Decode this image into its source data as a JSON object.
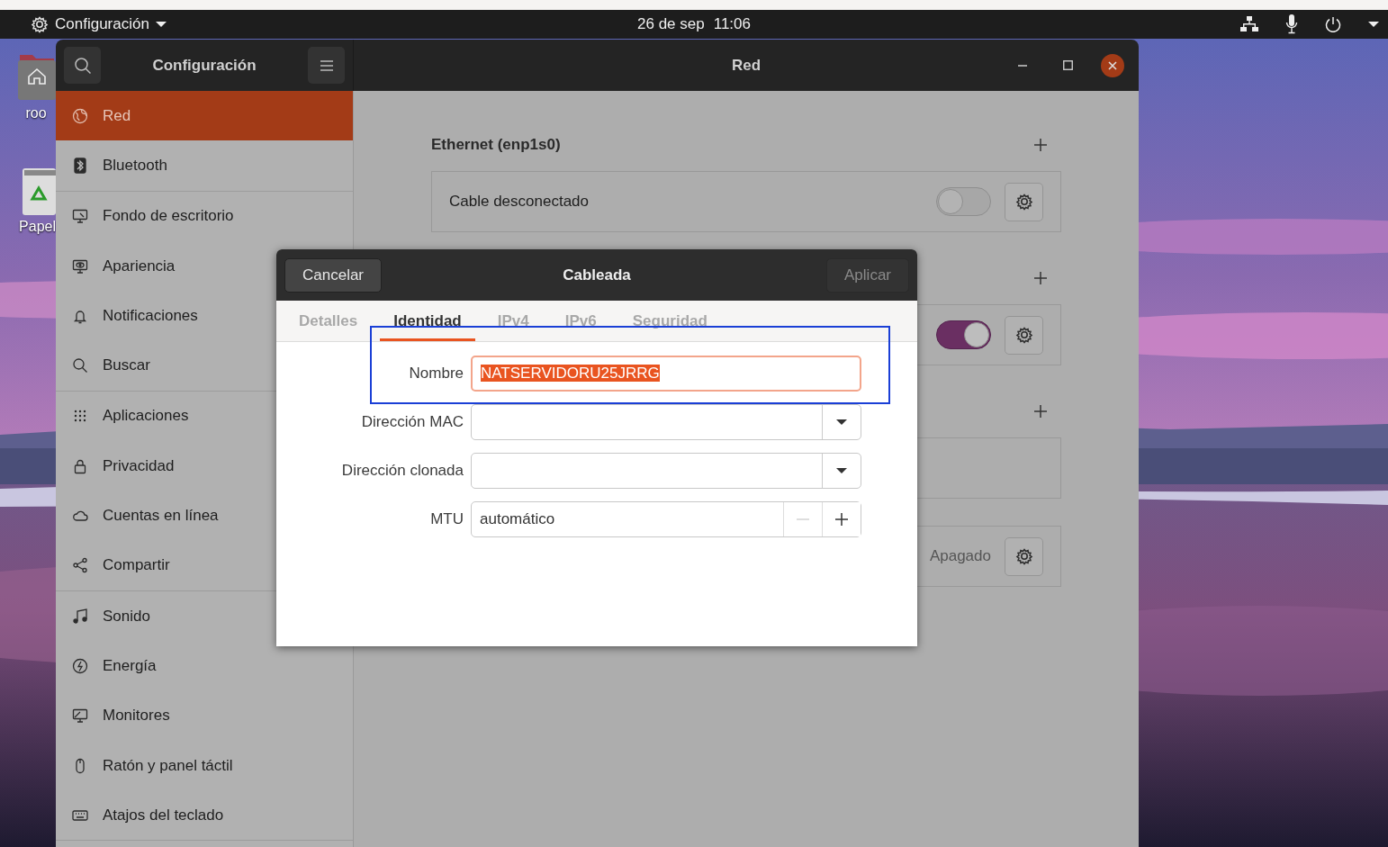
{
  "top_bar": {
    "app_menu": "Configuración",
    "date": "26 de sep",
    "time": "11:06"
  },
  "desktop_icons": [
    {
      "kind": "home",
      "label": "roo"
    },
    {
      "kind": "trash",
      "label": "Papel"
    }
  ],
  "settings": {
    "header_title": "Configuración",
    "page_title": "Red",
    "sidebar_groups": [
      {
        "items": [
          {
            "label": "Red",
            "selected": true
          },
          {
            "label": "Bluetooth",
            "selected": false
          }
        ]
      },
      {
        "items": [
          {
            "label": "Fondo de escritorio",
            "selected": false
          },
          {
            "label": "Apariencia",
            "selected": false
          },
          {
            "label": "Notificaciones",
            "selected": false
          },
          {
            "label": "Buscar",
            "selected": false
          }
        ]
      },
      {
        "items": [
          {
            "label": "Aplicaciones",
            "selected": false
          },
          {
            "label": "Privacidad",
            "selected": false
          },
          {
            "label": "Cuentas en línea",
            "selected": false
          },
          {
            "label": "Compartir",
            "selected": false
          }
        ]
      },
      {
        "items": [
          {
            "label": "Sonido",
            "selected": false
          },
          {
            "label": "Energía",
            "selected": false
          },
          {
            "label": "Monitores",
            "selected": false
          },
          {
            "label": "Ratón y panel táctil",
            "selected": false
          },
          {
            "label": "Atajos del teclado",
            "selected": false
          }
        ]
      }
    ],
    "sections": [
      {
        "title": "Ethernet (enp1s0)",
        "addable": true,
        "card": {
          "kind": "toggle",
          "label": "Cable desconectado",
          "on": false
        }
      },
      {
        "addable": true,
        "card": {
          "kind": "toggle",
          "on": true
        }
      },
      {
        "addable": true,
        "card": {
          "kind": "empty"
        }
      },
      {
        "addable": false,
        "card": {
          "kind": "status",
          "status": "Apagado"
        }
      }
    ]
  },
  "dialog": {
    "title": "Cableada",
    "cancel": "Cancelar",
    "apply": {
      "label": "Aplicar",
      "disabled": true
    },
    "tabs": [
      {
        "label": "Detalles",
        "selected": false
      },
      {
        "label": "Identidad",
        "selected": true
      },
      {
        "label": "IPv4",
        "selected": false
      },
      {
        "label": "IPv6",
        "selected": false
      },
      {
        "label": "Seguridad",
        "selected": false
      }
    ],
    "fields": [
      {
        "kind": "text",
        "label": "Nombre",
        "value": "NATSERVIDORU25JRRG",
        "text_selected": true
      },
      {
        "kind": "combo",
        "label": "Dirección MAC"
      },
      {
        "kind": "combo",
        "label": "Dirección clonada"
      },
      {
        "kind": "spin",
        "label": "MTU",
        "value": "automático",
        "buttons": [
          {
            "kind": "minus",
            "disabled": true
          },
          {
            "kind": "plus",
            "disabled": false
          }
        ]
      }
    ]
  }
}
